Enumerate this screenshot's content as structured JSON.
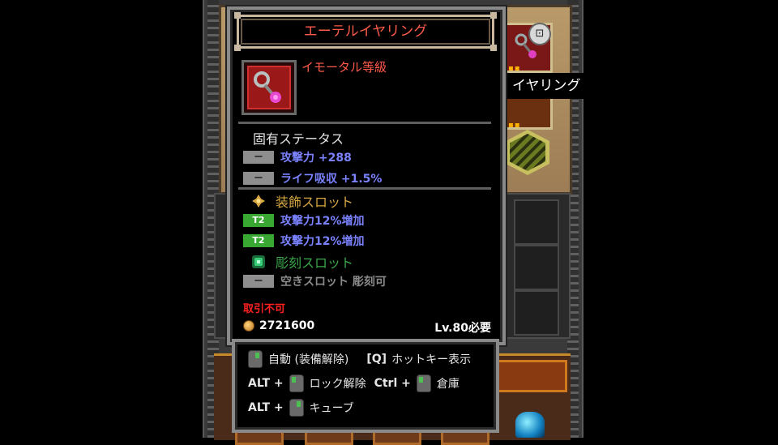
{
  "tooltip": {
    "item_name": "エーテルイヤリング",
    "grade": "イモータル等級",
    "inherent_stats": {
      "title": "固有ステータス",
      "lines": [
        {
          "badge": "ー",
          "text": "攻撃力 +288"
        },
        {
          "badge": "ー",
          "text": "ライフ吸収 +1.5%"
        }
      ]
    },
    "ornament_slot": {
      "title": "装飾スロット",
      "lines": [
        {
          "badge": "T2",
          "text": "攻撃力12%増加"
        },
        {
          "badge": "T2",
          "text": "攻撃力12%増加"
        }
      ]
    },
    "engraving_slot": {
      "title": "彫刻スロット",
      "lines": [
        {
          "badge": "ー",
          "text": "空きスロット 彫刻可"
        }
      ]
    },
    "untradeable": "取引不可",
    "price": "2721600",
    "level_requirement": "Lv.80必要"
  },
  "hints": {
    "auto_unequip": "自動 (装備解除)",
    "hotkey_key": "[Q]",
    "hotkey_label": "ホットキー表示",
    "alt1": "ALT +",
    "unlock": "ロック解除",
    "ctrl": "Ctrl +",
    "storage": "倉庫",
    "alt2": "ALT +",
    "cube": "キューブ"
  },
  "side_label": "イヤリング",
  "side_slots": {
    "stack_top": "▪▪",
    "stack_mid": "▪▪"
  },
  "colors": {
    "immortal_red": "#ff5a4a",
    "stat_blue": "#7a82ff",
    "t2_green": "#39a832",
    "ornament_gold": "#d8a840",
    "engraving_green": "#3aa84a",
    "untradeable_red": "#ff2020"
  },
  "icons": {
    "item": "earring-icon",
    "coin": "coin-icon",
    "mouse": "mouse-icon",
    "lock": "lock-icon"
  }
}
